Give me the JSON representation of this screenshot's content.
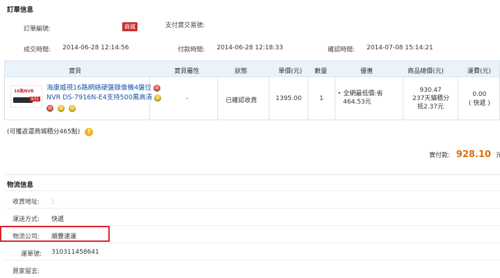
{
  "order_info": {
    "title": "訂單信息",
    "order_no_label": "訂單編號:",
    "mall_badge": "商城",
    "alipay_label": "支付寶交易號:",
    "created_label": "成交時間:",
    "created_value": "2014-06-28 12:14:56",
    "paid_label": "付款時間:",
    "paid_value": "2014-06-28 12:18:33",
    "confirmed_label": "確認時間:",
    "confirmed_value": "2014-07-08 15:14:21"
  },
  "table": {
    "headers": [
      "寶貝",
      "寶貝屬性",
      "狀態",
      "單價(元)",
      "數量",
      "優惠",
      "商品總價(元)",
      "運費(元)"
    ],
    "item": {
      "thumb_text": "16路NVR",
      "thumb_num": "931",
      "title_line1": "海康威視16路網絡硬盤錄像機4盤位",
      "title_line2": "NVR DS-7916N-E4支持500萬高清",
      "attribute": "-",
      "status": "已確認收貨",
      "unit_price": "1395.00",
      "quantity": "1",
      "discount_line1": "全網最低價:省",
      "discount_line2": "464.53元",
      "total_line1": "930.47",
      "total_line2": "237天貓積分",
      "total_line3": "抵2.37元",
      "shipping_fee": "0.00",
      "shipping_method": "( 快遞 )"
    }
  },
  "points_note": "(可獲返還商城積分465點)",
  "actual_payment": {
    "label": "實付款:",
    "amount": "928.10",
    "unit": "元"
  },
  "logistics": {
    "title": "物流信息",
    "address_label": "收貨地址:",
    "address_value": "：",
    "method_label": "運送方式:",
    "method_value": "快遞",
    "company_label": "物流公司:",
    "company_value": "順豐速運",
    "tracking_label": "運單號:",
    "tracking_value": "310311458641",
    "buyer_note_label": "買家留言:"
  },
  "colors": {
    "accent_blue": "#1a57a7",
    "header_bg": "#eaf3fb",
    "price_orange": "#e06b0a",
    "highlight_red": "#d8232a",
    "badge_red": "#c6302f"
  }
}
